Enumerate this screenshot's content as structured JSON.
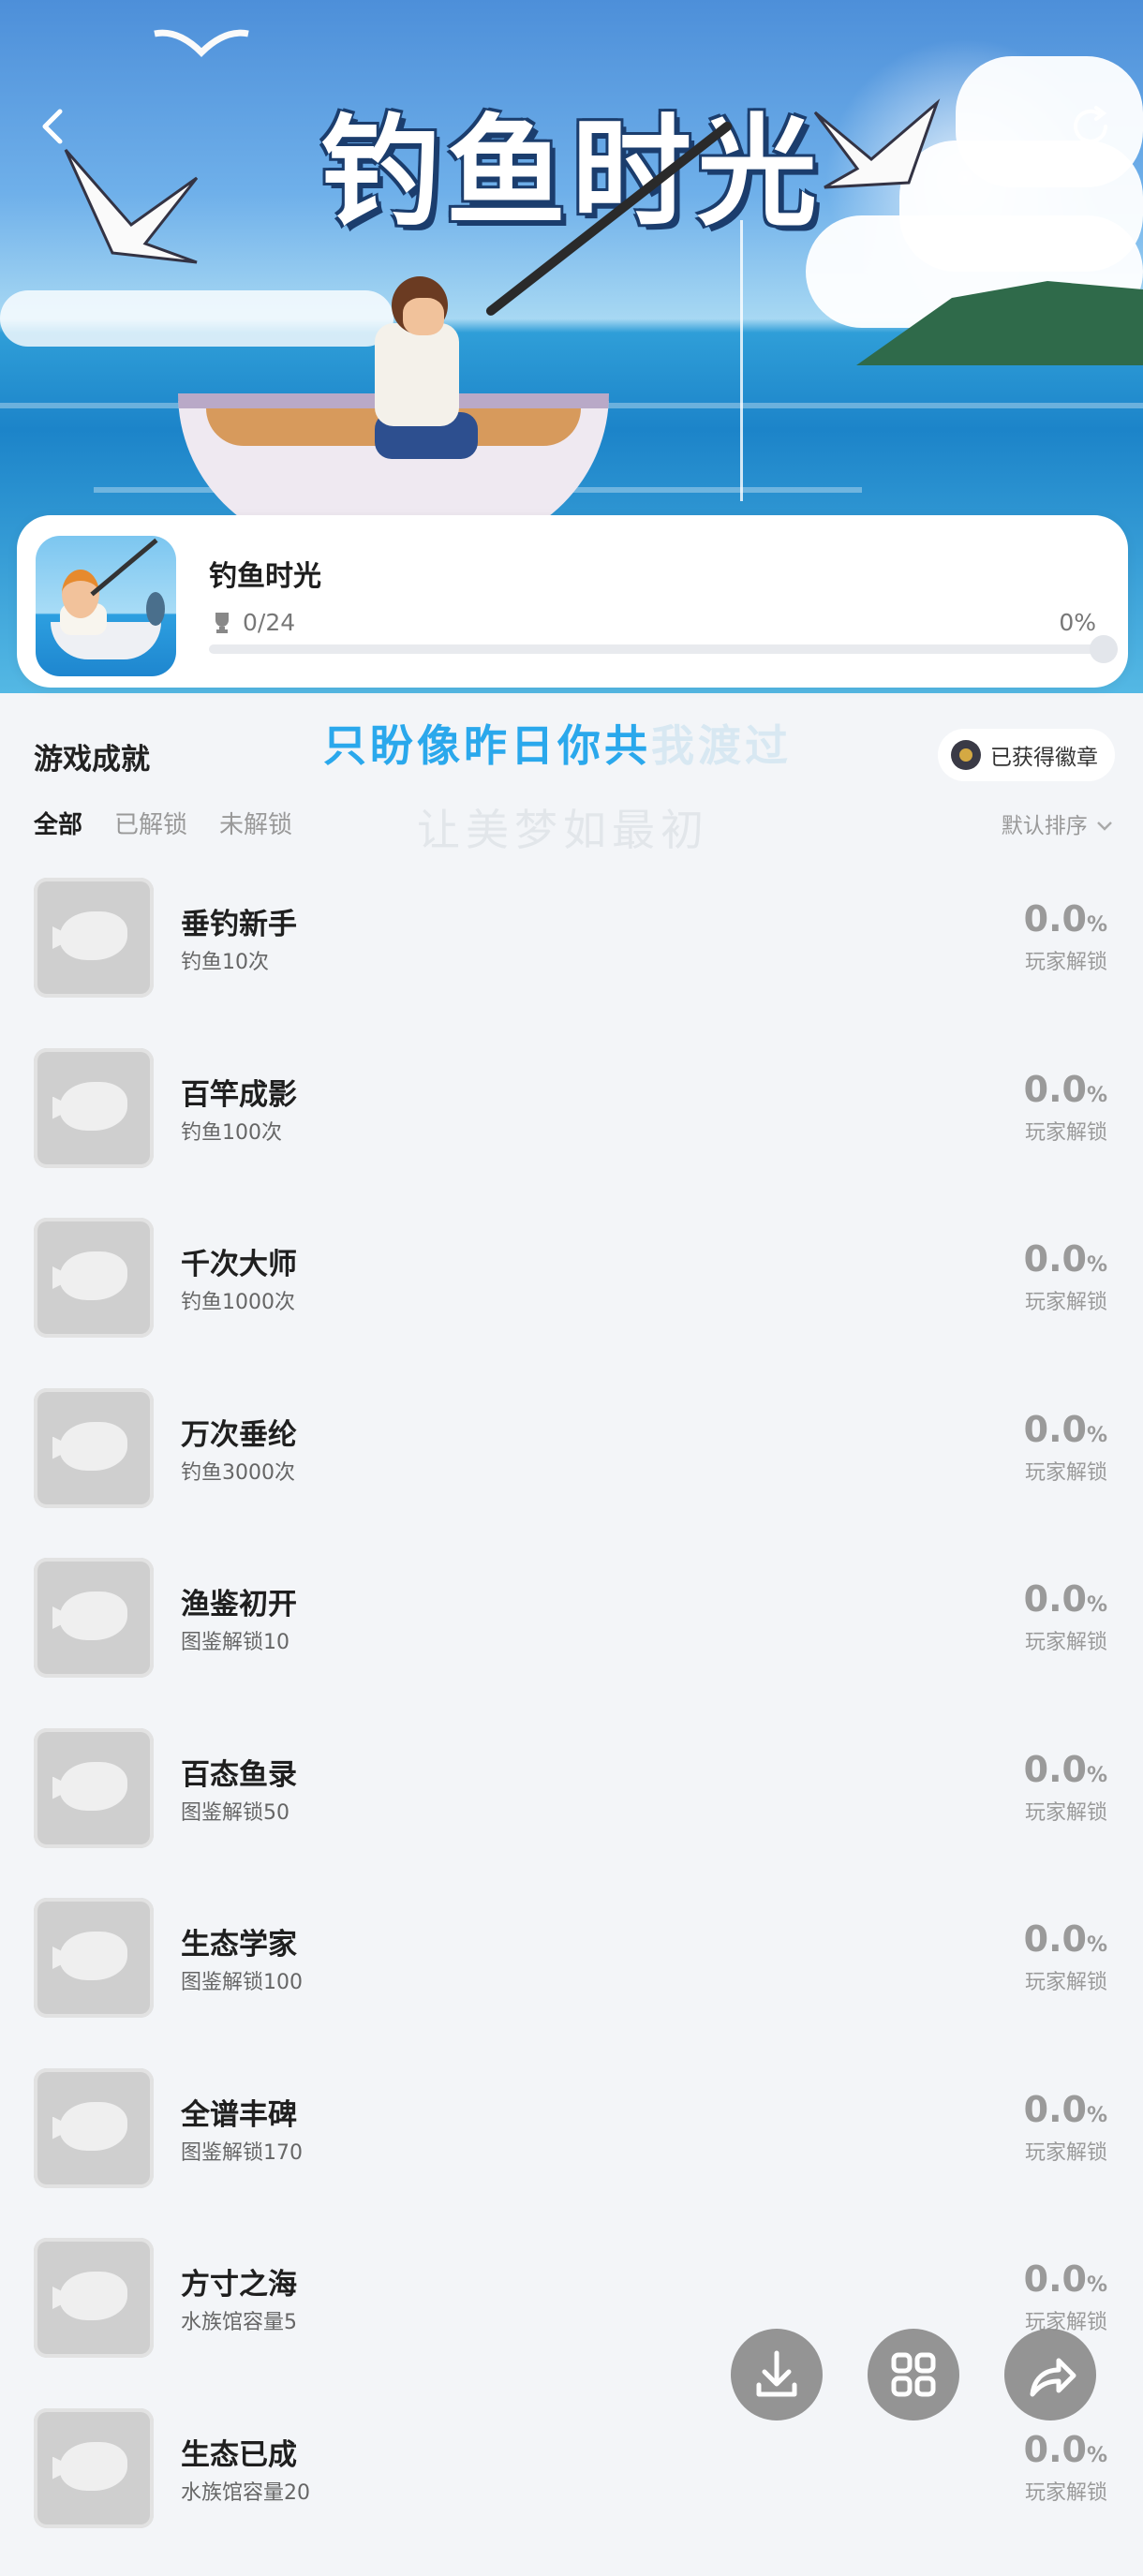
{
  "hero": {
    "title": "钓鱼时光",
    "back_icon": "chevron-left-icon",
    "refresh_icon": "refresh-icon"
  },
  "game": {
    "name": "钓鱼时光",
    "trophy_count": "0/24",
    "progress_text": "0%",
    "progress": 0,
    "accent_color": "#2f86e0"
  },
  "achievements_section": {
    "title": "游戏成就",
    "badge_button": "已获得徽章"
  },
  "lyrics": {
    "line1_a": "只盼像昨日你共",
    "line1_b": "我渡过",
    "line2": "让美梦如最初"
  },
  "tabs": [
    "全部",
    "已解锁",
    "未解锁"
  ],
  "sort_label": "默认排序",
  "achievements": [
    {
      "name": "垂钓新手",
      "desc": "钓鱼10次",
      "pct": "0.0",
      "sub": "玩家解锁"
    },
    {
      "name": "百竿成影",
      "desc": "钓鱼100次",
      "pct": "0.0",
      "sub": "玩家解锁"
    },
    {
      "name": "千次大师",
      "desc": "钓鱼1000次",
      "pct": "0.0",
      "sub": "玩家解锁"
    },
    {
      "name": "万次垂纶",
      "desc": "钓鱼3000次",
      "pct": "0.0",
      "sub": "玩家解锁"
    },
    {
      "name": "渔鉴初开",
      "desc": "图鉴解锁10",
      "pct": "0.0",
      "sub": "玩家解锁"
    },
    {
      "name": "百态鱼录",
      "desc": "图鉴解锁50",
      "pct": "0.0",
      "sub": "玩家解锁"
    },
    {
      "name": "生态学家",
      "desc": "图鉴解锁100",
      "pct": "0.0",
      "sub": "玩家解锁"
    },
    {
      "name": "全谱丰碑",
      "desc": "图鉴解锁170",
      "pct": "0.0",
      "sub": "玩家解锁"
    },
    {
      "name": "方寸之海",
      "desc": "水族馆容量5",
      "pct": "0.0",
      "sub": "玩家解锁"
    },
    {
      "name": "生态已成",
      "desc": "水族馆容量20",
      "pct": "0.0",
      "sub": "玩家解锁"
    }
  ],
  "percent_sign": "%",
  "fabs": [
    "download-icon",
    "grid-icon",
    "share-icon"
  ]
}
